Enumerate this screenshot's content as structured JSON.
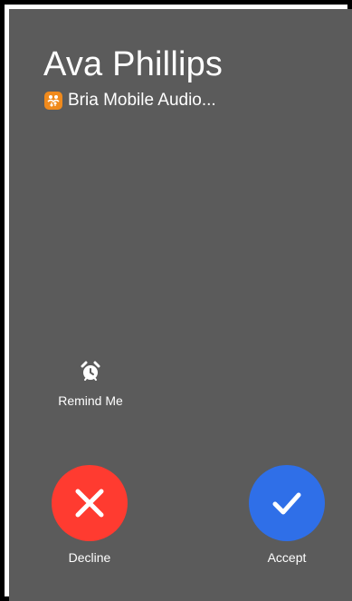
{
  "call": {
    "caller_name": "Ava Phillips",
    "app_name": "Bria Mobile Audio..."
  },
  "actions": {
    "remind_label": "Remind Me",
    "decline_label": "Decline",
    "accept_label": "Accept"
  },
  "icons": {
    "app": "bria-app-icon",
    "remind": "alarm-clock-icon",
    "decline": "close-icon",
    "accept": "checkmark-icon"
  },
  "colors": {
    "background": "#5b5b5b",
    "decline": "#ff3b30",
    "accept": "#2f6fe8",
    "app_icon": "#f08a1c"
  }
}
